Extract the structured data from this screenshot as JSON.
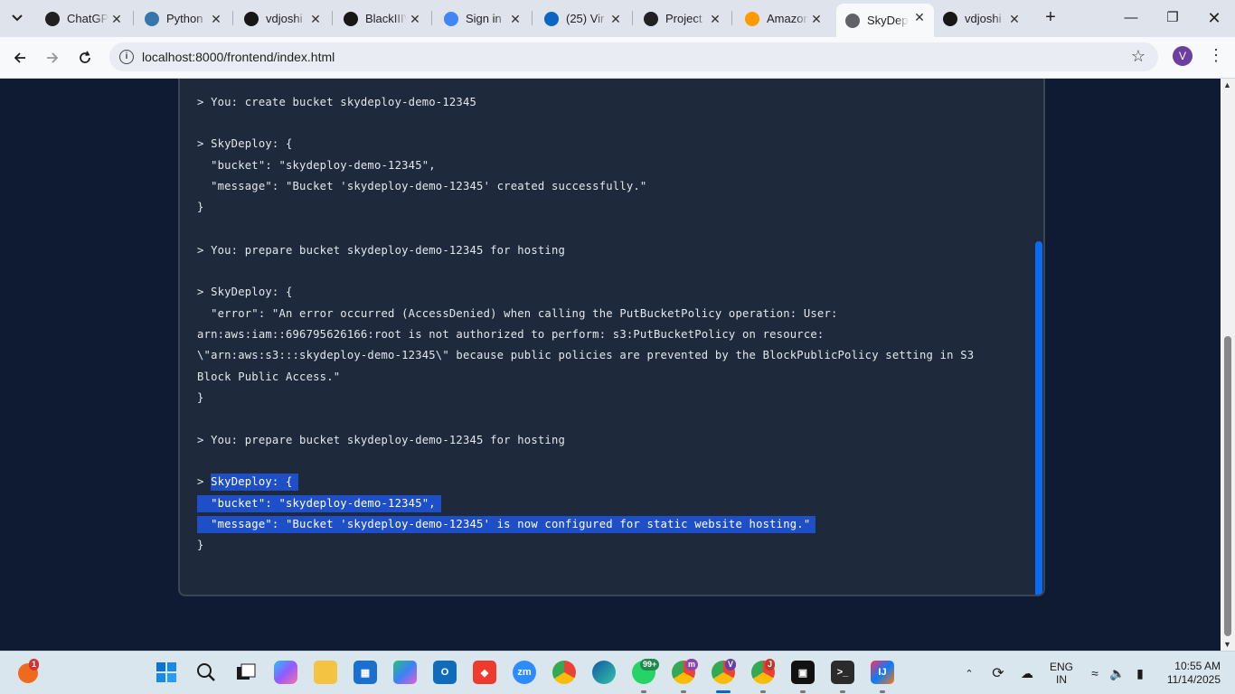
{
  "browser": {
    "tabs": [
      {
        "title": "ChatGPT",
        "icon": "chatgpt-icon",
        "color": "#202123"
      },
      {
        "title": "Python",
        "icon": "python-icon",
        "color": "#3776ab"
      },
      {
        "title": "vdjoshi",
        "icon": "github-icon",
        "color": "#181717"
      },
      {
        "title": "BlackIIIV",
        "icon": "github-icon",
        "color": "#181717"
      },
      {
        "title": "Sign in",
        "icon": "google-icon",
        "color": "#4285f4"
      },
      {
        "title": "(25) Vir",
        "icon": "linkedin-icon",
        "color": "#0a66c2"
      },
      {
        "title": "Project",
        "icon": "chatgpt-icon",
        "color": "#202123"
      },
      {
        "title": "Amazon",
        "icon": "aws-cube-icon",
        "color": "#ff9900"
      },
      {
        "title": "SkyDep",
        "icon": "globe-icon",
        "color": "#5f6368",
        "active": true
      },
      {
        "title": "vdjoshi",
        "icon": "github-icon",
        "color": "#181717"
      }
    ],
    "url": "localhost:8000/frontend/index.html",
    "profile_initial": "V"
  },
  "console": {
    "lines": [
      {
        "text": "}",
        "selected": false
      },
      {
        "text": "> You: create bucket skydeploy-demo-12345",
        "selected": false
      },
      {
        "text": "> SkyDeploy: {",
        "selected": false
      },
      {
        "text": "  \"bucket\": \"skydeploy-demo-12345\",",
        "selected": false
      },
      {
        "text": "  \"message\": \"Bucket 'skydeploy-demo-12345' created successfully.\"",
        "selected": false
      },
      {
        "text": "}",
        "selected": false
      },
      {
        "text": "> You: prepare bucket skydeploy-demo-12345 for hosting",
        "selected": false
      },
      {
        "text": "> SkyDeploy: {",
        "selected": false
      },
      {
        "text": "  \"error\": \"An error occurred (AccessDenied) when calling the PutBucketPolicy operation: User:",
        "selected": false
      },
      {
        "text": "arn:aws:iam::696795626166:root is not authorized to perform: s3:PutBucketPolicy on resource:",
        "selected": false
      },
      {
        "text": "\\\"arn:aws:s3:::skydeploy-demo-12345\\\" because public policies are prevented by the BlockPublicPolicy setting in S3",
        "selected": false
      },
      {
        "text": "Block Public Access.\"",
        "selected": false
      },
      {
        "text": "}",
        "selected": false
      },
      {
        "text": "> You: prepare bucket skydeploy-demo-12345 for hosting",
        "selected": false
      },
      {
        "prefix": "> ",
        "text": "SkyDeploy: {",
        "selected": true
      },
      {
        "text": "  \"bucket\": \"skydeploy-demo-12345\",",
        "selected": true
      },
      {
        "text": "  \"message\": \"Bucket 'skydeploy-demo-12345' is now configured for static website hosting.\"",
        "selected": true
      },
      {
        "text": "}",
        "selected": false
      }
    ]
  },
  "taskbar": {
    "notification_count": "1",
    "whatsapp_badge": "99+",
    "chrome_profile_m": "m",
    "chrome_profile_v": "V",
    "chrome_profile_j": "J",
    "language_top": "ENG",
    "language_bottom": "IN",
    "time": "10:55 AM",
    "date": "11/14/2025",
    "apps": [
      "start-icon",
      "search-icon",
      "task-view-icon",
      "copilot-icon",
      "file-explorer-icon",
      "microsoft-store-icon",
      "m365-icon",
      "outlook-icon",
      "anydesk-icon",
      "zoom-icon",
      "chrome-icon",
      "edge-icon",
      "whatsapp-icon",
      "chrome-profile-m-icon",
      "chrome-profile-v-icon",
      "chrome-profile-j-icon",
      "capcut-icon",
      "terminal-icon",
      "intellij-icon"
    ]
  }
}
